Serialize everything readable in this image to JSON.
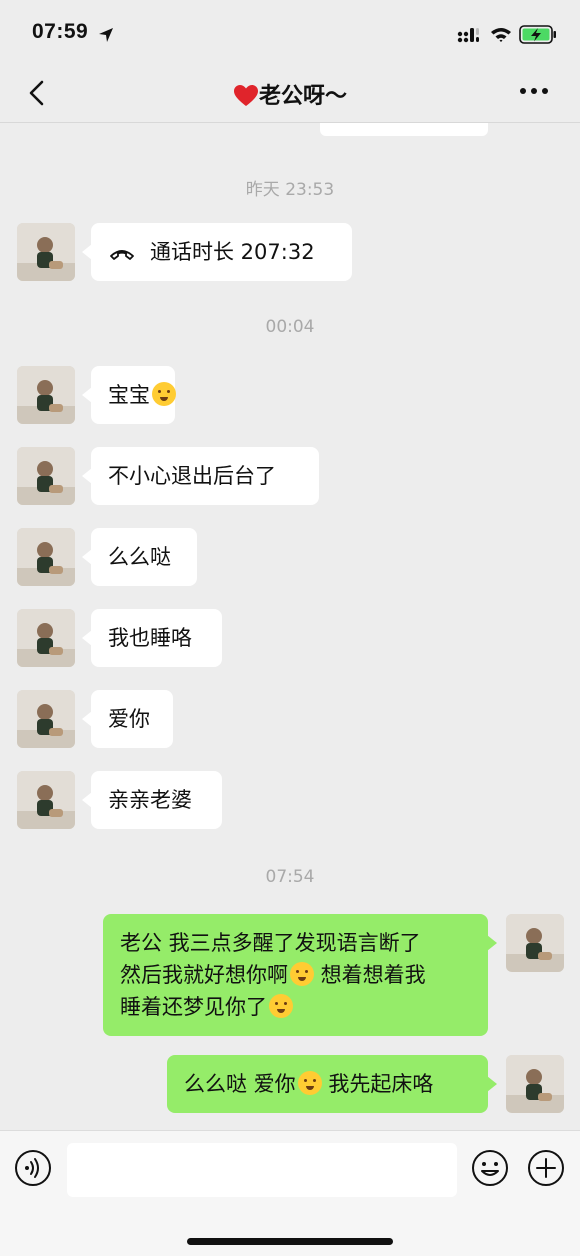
{
  "status": {
    "time": "07:59"
  },
  "header": {
    "title": "老公呀～"
  },
  "timestamps": [
    "昨天 23:53",
    "00:04",
    "07:54"
  ],
  "messages": [
    {
      "side": "in",
      "call": true,
      "text": "通话时长 207:32"
    },
    {
      "side": "in",
      "text": "宝宝",
      "emoji": "crying-face-emoji"
    },
    {
      "side": "in",
      "text": "不小心退出后台了"
    },
    {
      "side": "in",
      "text": "么么哒"
    },
    {
      "side": "in",
      "text": "我也睡咯"
    },
    {
      "side": "in",
      "text": "爱你"
    },
    {
      "side": "in",
      "text": "亲亲老婆"
    },
    {
      "side": "out",
      "line1": "老公 我三点多醒了发现语言断了",
      "line2a": "然后我就好想你啊",
      "line2b": " 想着想着我",
      "line3": "睡着还梦见你了",
      "emojis": [
        "hugging-face-emoji",
        "crying-laughing-emoji"
      ]
    },
    {
      "side": "out",
      "part1": "么么哒 爱你",
      "part2": " 我先起床咯",
      "emoji": "kissing-face-emoji"
    }
  ],
  "colors": {
    "outgoing_bubble": "#95ec69",
    "incoming_bubble": "#ffffff",
    "background": "#ededed"
  }
}
